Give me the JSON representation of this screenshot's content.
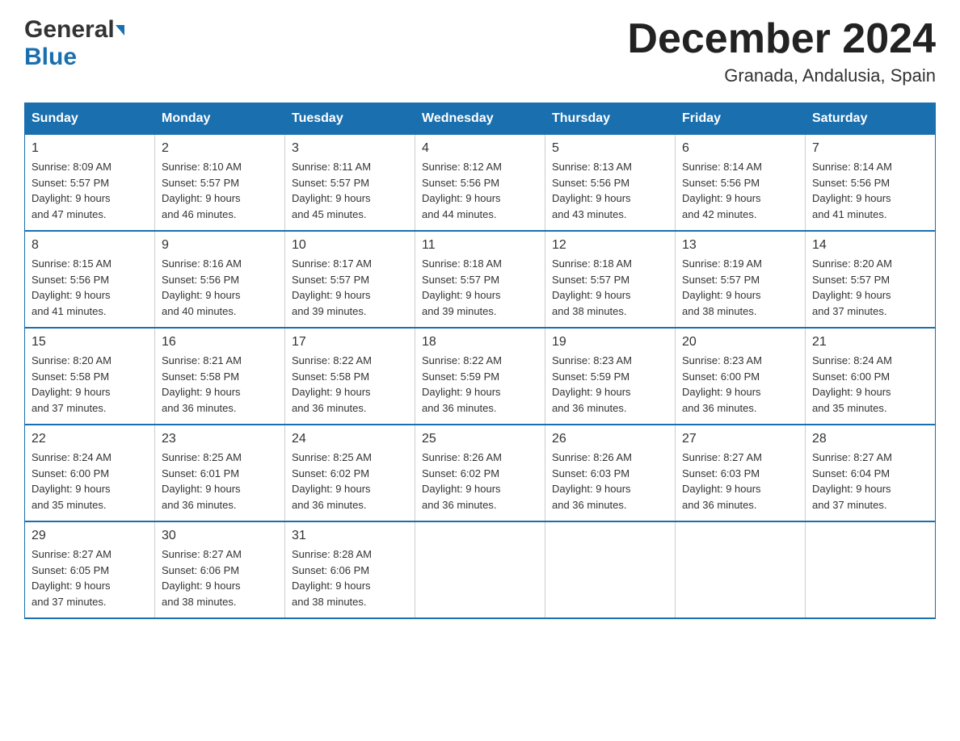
{
  "header": {
    "logo_general": "General",
    "logo_blue": "Blue",
    "title": "December 2024",
    "subtitle": "Granada, Andalusia, Spain"
  },
  "calendar": {
    "days_of_week": [
      "Sunday",
      "Monday",
      "Tuesday",
      "Wednesday",
      "Thursday",
      "Friday",
      "Saturday"
    ],
    "weeks": [
      [
        {
          "day": "1",
          "sunrise": "Sunrise: 8:09 AM",
          "sunset": "Sunset: 5:57 PM",
          "daylight": "Daylight: 9 hours",
          "daylight2": "and 47 minutes."
        },
        {
          "day": "2",
          "sunrise": "Sunrise: 8:10 AM",
          "sunset": "Sunset: 5:57 PM",
          "daylight": "Daylight: 9 hours",
          "daylight2": "and 46 minutes."
        },
        {
          "day": "3",
          "sunrise": "Sunrise: 8:11 AM",
          "sunset": "Sunset: 5:57 PM",
          "daylight": "Daylight: 9 hours",
          "daylight2": "and 45 minutes."
        },
        {
          "day": "4",
          "sunrise": "Sunrise: 8:12 AM",
          "sunset": "Sunset: 5:56 PM",
          "daylight": "Daylight: 9 hours",
          "daylight2": "and 44 minutes."
        },
        {
          "day": "5",
          "sunrise": "Sunrise: 8:13 AM",
          "sunset": "Sunset: 5:56 PM",
          "daylight": "Daylight: 9 hours",
          "daylight2": "and 43 minutes."
        },
        {
          "day": "6",
          "sunrise": "Sunrise: 8:14 AM",
          "sunset": "Sunset: 5:56 PM",
          "daylight": "Daylight: 9 hours",
          "daylight2": "and 42 minutes."
        },
        {
          "day": "7",
          "sunrise": "Sunrise: 8:14 AM",
          "sunset": "Sunset: 5:56 PM",
          "daylight": "Daylight: 9 hours",
          "daylight2": "and 41 minutes."
        }
      ],
      [
        {
          "day": "8",
          "sunrise": "Sunrise: 8:15 AM",
          "sunset": "Sunset: 5:56 PM",
          "daylight": "Daylight: 9 hours",
          "daylight2": "and 41 minutes."
        },
        {
          "day": "9",
          "sunrise": "Sunrise: 8:16 AM",
          "sunset": "Sunset: 5:56 PM",
          "daylight": "Daylight: 9 hours",
          "daylight2": "and 40 minutes."
        },
        {
          "day": "10",
          "sunrise": "Sunrise: 8:17 AM",
          "sunset": "Sunset: 5:57 PM",
          "daylight": "Daylight: 9 hours",
          "daylight2": "and 39 minutes."
        },
        {
          "day": "11",
          "sunrise": "Sunrise: 8:18 AM",
          "sunset": "Sunset: 5:57 PM",
          "daylight": "Daylight: 9 hours",
          "daylight2": "and 39 minutes."
        },
        {
          "day": "12",
          "sunrise": "Sunrise: 8:18 AM",
          "sunset": "Sunset: 5:57 PM",
          "daylight": "Daylight: 9 hours",
          "daylight2": "and 38 minutes."
        },
        {
          "day": "13",
          "sunrise": "Sunrise: 8:19 AM",
          "sunset": "Sunset: 5:57 PM",
          "daylight": "Daylight: 9 hours",
          "daylight2": "and 38 minutes."
        },
        {
          "day": "14",
          "sunrise": "Sunrise: 8:20 AM",
          "sunset": "Sunset: 5:57 PM",
          "daylight": "Daylight: 9 hours",
          "daylight2": "and 37 minutes."
        }
      ],
      [
        {
          "day": "15",
          "sunrise": "Sunrise: 8:20 AM",
          "sunset": "Sunset: 5:58 PM",
          "daylight": "Daylight: 9 hours",
          "daylight2": "and 37 minutes."
        },
        {
          "day": "16",
          "sunrise": "Sunrise: 8:21 AM",
          "sunset": "Sunset: 5:58 PM",
          "daylight": "Daylight: 9 hours",
          "daylight2": "and 36 minutes."
        },
        {
          "day": "17",
          "sunrise": "Sunrise: 8:22 AM",
          "sunset": "Sunset: 5:58 PM",
          "daylight": "Daylight: 9 hours",
          "daylight2": "and 36 minutes."
        },
        {
          "day": "18",
          "sunrise": "Sunrise: 8:22 AM",
          "sunset": "Sunset: 5:59 PM",
          "daylight": "Daylight: 9 hours",
          "daylight2": "and 36 minutes."
        },
        {
          "day": "19",
          "sunrise": "Sunrise: 8:23 AM",
          "sunset": "Sunset: 5:59 PM",
          "daylight": "Daylight: 9 hours",
          "daylight2": "and 36 minutes."
        },
        {
          "day": "20",
          "sunrise": "Sunrise: 8:23 AM",
          "sunset": "Sunset: 6:00 PM",
          "daylight": "Daylight: 9 hours",
          "daylight2": "and 36 minutes."
        },
        {
          "day": "21",
          "sunrise": "Sunrise: 8:24 AM",
          "sunset": "Sunset: 6:00 PM",
          "daylight": "Daylight: 9 hours",
          "daylight2": "and 35 minutes."
        }
      ],
      [
        {
          "day": "22",
          "sunrise": "Sunrise: 8:24 AM",
          "sunset": "Sunset: 6:00 PM",
          "daylight": "Daylight: 9 hours",
          "daylight2": "and 35 minutes."
        },
        {
          "day": "23",
          "sunrise": "Sunrise: 8:25 AM",
          "sunset": "Sunset: 6:01 PM",
          "daylight": "Daylight: 9 hours",
          "daylight2": "and 36 minutes."
        },
        {
          "day": "24",
          "sunrise": "Sunrise: 8:25 AM",
          "sunset": "Sunset: 6:02 PM",
          "daylight": "Daylight: 9 hours",
          "daylight2": "and 36 minutes."
        },
        {
          "day": "25",
          "sunrise": "Sunrise: 8:26 AM",
          "sunset": "Sunset: 6:02 PM",
          "daylight": "Daylight: 9 hours",
          "daylight2": "and 36 minutes."
        },
        {
          "day": "26",
          "sunrise": "Sunrise: 8:26 AM",
          "sunset": "Sunset: 6:03 PM",
          "daylight": "Daylight: 9 hours",
          "daylight2": "and 36 minutes."
        },
        {
          "day": "27",
          "sunrise": "Sunrise: 8:27 AM",
          "sunset": "Sunset: 6:03 PM",
          "daylight": "Daylight: 9 hours",
          "daylight2": "and 36 minutes."
        },
        {
          "day": "28",
          "sunrise": "Sunrise: 8:27 AM",
          "sunset": "Sunset: 6:04 PM",
          "daylight": "Daylight: 9 hours",
          "daylight2": "and 37 minutes."
        }
      ],
      [
        {
          "day": "29",
          "sunrise": "Sunrise: 8:27 AM",
          "sunset": "Sunset: 6:05 PM",
          "daylight": "Daylight: 9 hours",
          "daylight2": "and 37 minutes."
        },
        {
          "day": "30",
          "sunrise": "Sunrise: 8:27 AM",
          "sunset": "Sunset: 6:06 PM",
          "daylight": "Daylight: 9 hours",
          "daylight2": "and 38 minutes."
        },
        {
          "day": "31",
          "sunrise": "Sunrise: 8:28 AM",
          "sunset": "Sunset: 6:06 PM",
          "daylight": "Daylight: 9 hours",
          "daylight2": "and 38 minutes."
        },
        null,
        null,
        null,
        null
      ]
    ]
  }
}
